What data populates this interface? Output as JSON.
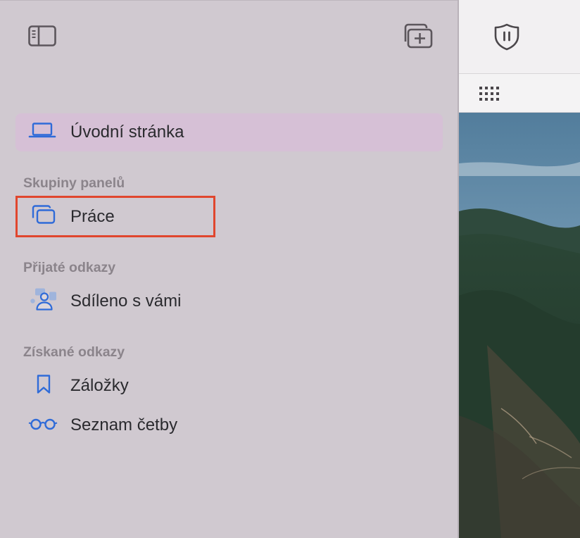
{
  "sidebar": {
    "home_label": "Úvodní stránka",
    "tab_groups_header": "Skupiny panelů",
    "tab_groups": [
      {
        "label": "Práce"
      }
    ],
    "received_header": "Přijaté odkazy",
    "shared_label": "Sdíleno s vámi",
    "saved_header": "Získané odkazy",
    "bookmarks_label": "Záložky",
    "reading_list_label": "Seznam četby"
  },
  "icons": {
    "sidebar_toggle": "sidebar-toggle-icon",
    "new_tab_group": "new-tab-group-icon",
    "privacy": "privacy-shield-icon",
    "grid": "grid-icon",
    "home": "laptop-icon",
    "tab_group": "tab-group-icon",
    "shared": "shared-with-you-icon",
    "bookmark": "bookmark-icon",
    "reading_list": "glasses-icon"
  },
  "colors": {
    "accent": "#2f6bd8",
    "sidebar_bg": "#d0c9d0",
    "selected_bg": "#d6c0d6",
    "highlight": "#e0462e"
  }
}
